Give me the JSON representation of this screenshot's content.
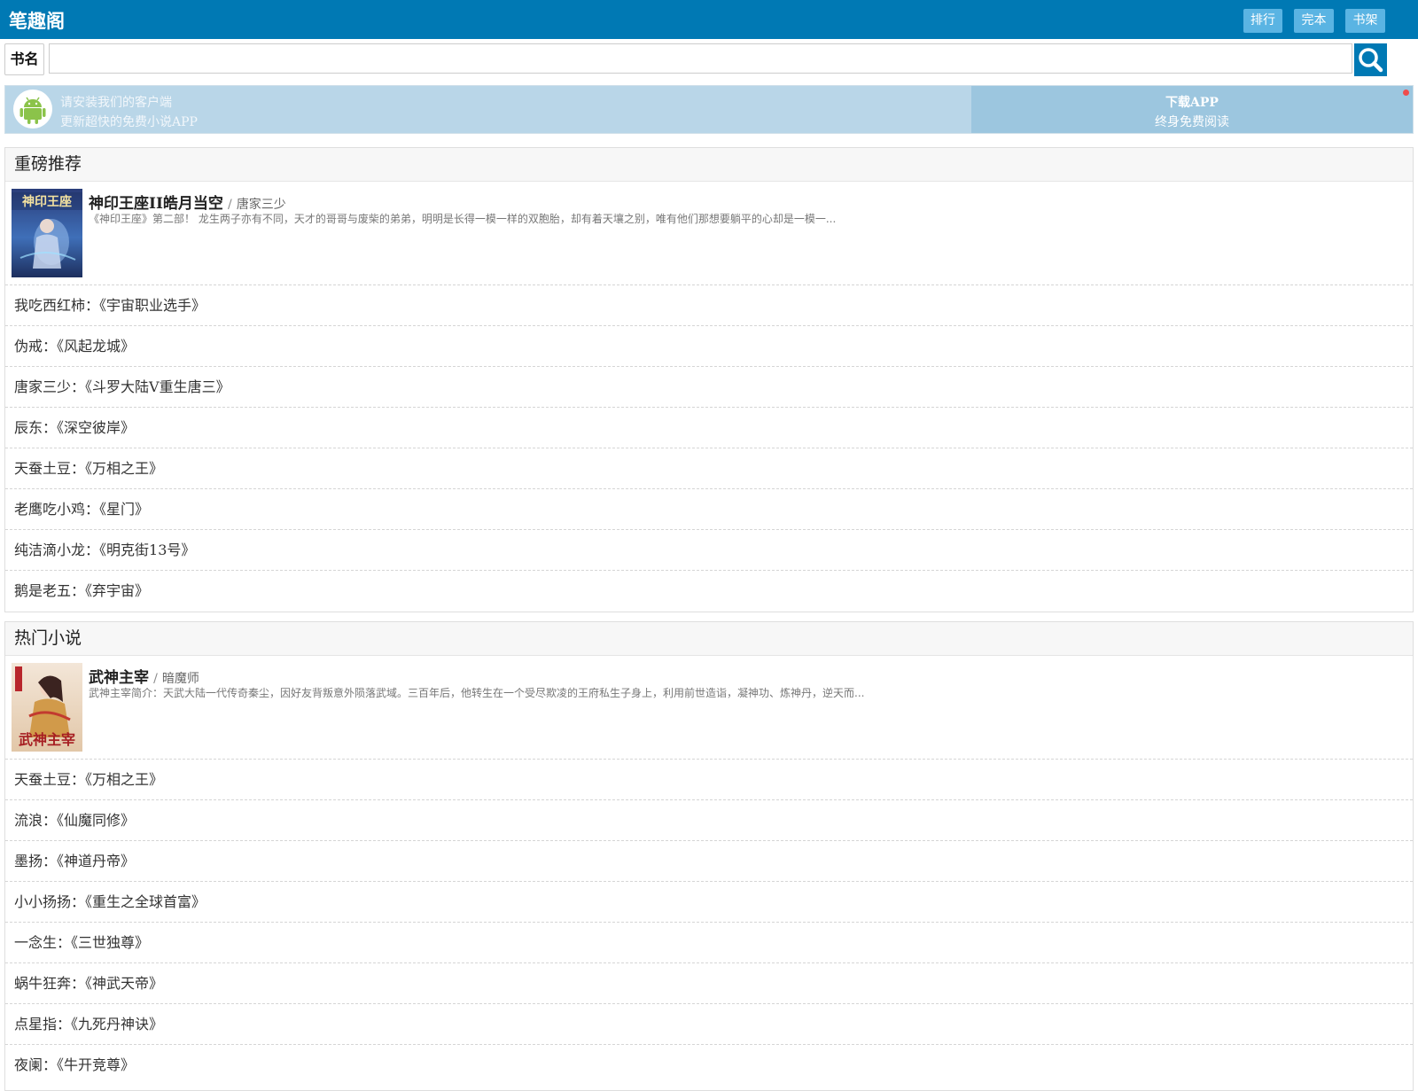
{
  "header": {
    "logo": "笔趣阁",
    "nav": [
      {
        "label": "排行"
      },
      {
        "label": "完本"
      },
      {
        "label": "书架"
      }
    ]
  },
  "search": {
    "label": "书名",
    "value": "",
    "placeholder": ""
  },
  "app_banner": {
    "line1": "请安装我们的客户端",
    "line2": "更新超快的免费小说APP",
    "download_title": "下载APP",
    "download_sub": "终身免费阅读"
  },
  "recommend": {
    "title": "重磅推荐",
    "featured": {
      "name": "神印王座II皓月当空",
      "separator": "/",
      "author": "唐家三少",
      "desc": "《神印王座》第二部！ 龙生两子亦有不同，天才的哥哥与废柴的弟弟，明明是长得一模一样的双胞胎，却有着天壤之别，唯有他们那想要躺平的心却是一模一...",
      "cover_text": "神印王座"
    },
    "items": [
      {
        "author": "我吃西红柿",
        "book": "《宇宙职业选手》"
      },
      {
        "author": "伪戒",
        "book": "《风起龙城》"
      },
      {
        "author": "唐家三少",
        "book": "《斗罗大陆V重生唐三》"
      },
      {
        "author": "辰东",
        "book": "《深空彼岸》"
      },
      {
        "author": "天蚕土豆",
        "book": "《万相之王》"
      },
      {
        "author": "老鹰吃小鸡",
        "book": "《星门》"
      },
      {
        "author": "纯洁滴小龙",
        "book": "《明克街13号》"
      },
      {
        "author": "鹅是老五",
        "book": "《弃宇宙》"
      }
    ]
  },
  "hot": {
    "title": "热门小说",
    "featured": {
      "name": "武神主宰",
      "separator": "/",
      "author": "暗魔师",
      "desc": "武神主宰简介：天武大陆一代传奇秦尘，因好友背叛意外陨落武域。三百年后，他转生在一个受尽欺凌的王府私生子身上，利用前世造诣，凝神功、炼神丹，逆天而...",
      "cover_text": "武神主宰"
    },
    "items": [
      {
        "author": "天蚕土豆",
        "book": "《万相之王》"
      },
      {
        "author": "流浪",
        "book": "《仙魔同修》"
      },
      {
        "author": "墨扬",
        "book": "《神道丹帝》"
      },
      {
        "author": "小小扬扬",
        "book": "《重生之全球首富》"
      },
      {
        "author": "一念生",
        "book": "《三世独尊》"
      },
      {
        "author": "蜗牛狂奔",
        "book": "《神武天帝》"
      },
      {
        "author": "点星指",
        "book": "《九死丹神诀》"
      },
      {
        "author": "夜阑",
        "book": "《牛开竞尊》"
      }
    ]
  },
  "colors": {
    "header_bg": "#0079b4",
    "nav_button": "#5ab4e3",
    "banner_bg": "#b9d6e8",
    "download_bg": "#9cc6df",
    "android_green": "#8bc34a"
  }
}
